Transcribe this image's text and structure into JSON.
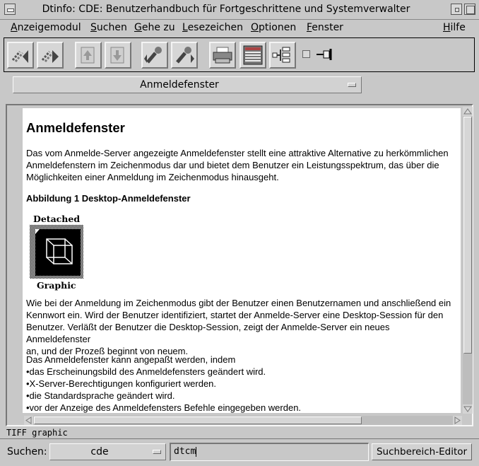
{
  "window": {
    "title": "Dtinfo: CDE: Benutzerhandbuch für Fortgeschrittene und Systemverwalter"
  },
  "menubar": {
    "items": [
      {
        "mnemonic": "A",
        "rest": "nzeigemodul"
      },
      {
        "mnemonic": "S",
        "rest": "uchen"
      },
      {
        "mnemonic": "G",
        "rest": "ehe zu"
      },
      {
        "mnemonic": "L",
        "rest": "esezeichen"
      },
      {
        "mnemonic": "O",
        "rest": "ptionen"
      },
      {
        "mnemonic": "F",
        "rest": "enster"
      },
      {
        "mnemonic": "H",
        "rest": "ilfe"
      }
    ]
  },
  "toolbar": {
    "icons": [
      "history-back-icon",
      "history-forward-icon",
      "previous-section-icon",
      "next-section-icon",
      "search-previous-icon",
      "search-next-icon",
      "print-icon",
      "graphics-list-icon",
      "node-map-icon",
      "pin-icon"
    ],
    "pin_checked": false
  },
  "section": {
    "current": "Anmeldefenster"
  },
  "document": {
    "heading": "Anmeldefenster",
    "intro_lines": [
      "Das vom Anmelde-Server angezeigte Anmeldefenster stellt eine attraktive Alternative zu herkömmlichen",
      "Anmeldefenstern im Zeichenmodus dar und bietet dem Benutzer ein Leistungsspektrum, das über die",
      "Möglichkeiten einer Anmeldung im Zeichenmodus hinausgeht."
    ],
    "figure_caption": "Abbildung 1   Desktop-Anmeldefenster",
    "figure_top_label": "Detached",
    "figure_bottom_label": "Graphic",
    "body_lines": [
      "Wie bei der Anmeldung im Zeichenmodus gibt der Benutzer einen Benutzernamen und anschließend ein",
      "Kennwort ein. Wird der Benutzer identifiziert, startet der Anmelde-Server eine Desktop-Session für den",
      "Benutzer. Verläßt der Benutzer die Desktop-Session, zeigt der Anmelde-Server ein neues Anmeldefenster",
      "an, und der Prozeß beginnt von neuem."
    ],
    "list_intro": "Das Anmeldefenster kann angepaßt werden, indem",
    "list_items": [
      "•das Erscheinungsbild des Anmeldefensters geändert wird.",
      "•X-Server-Berechtigungen konfiguriert werden.",
      "•die Standardsprache geändert wird.",
      "•vor der Anzeige des Anmeldefensters Befehle eingegeben werden."
    ]
  },
  "status": {
    "text": "TIFF graphic"
  },
  "search": {
    "label": "Suchen:",
    "scope": "cde",
    "query": "dtcm",
    "scope_editor_label": "Suchbereich-Editor"
  }
}
